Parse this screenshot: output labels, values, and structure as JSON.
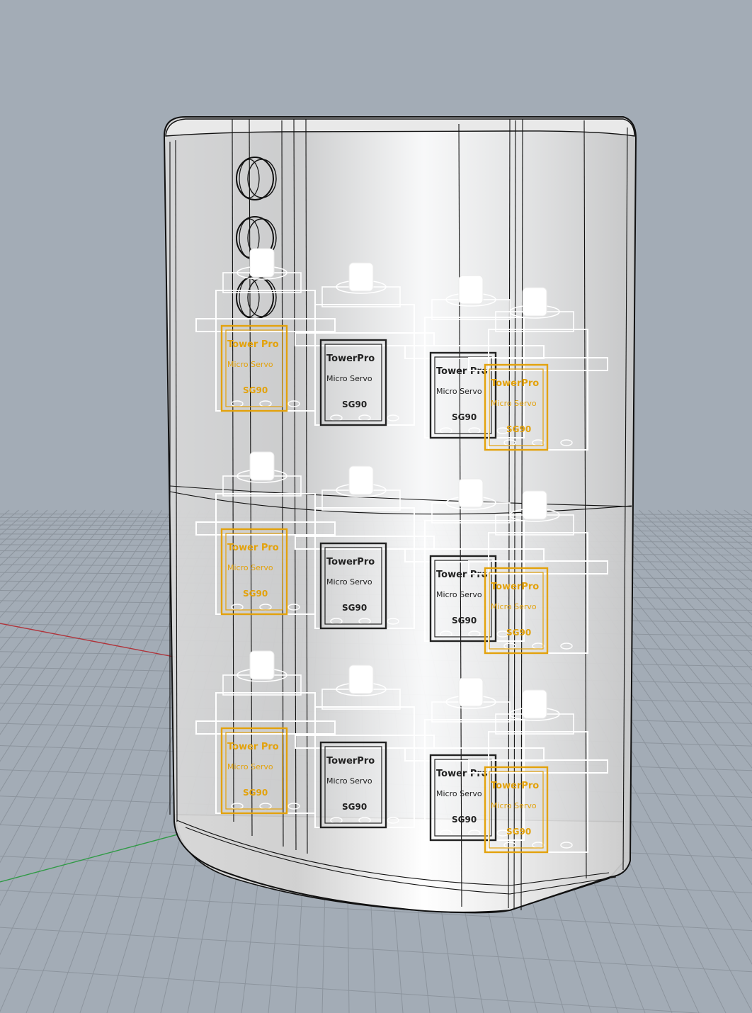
{
  "viewport": {
    "background": "#a3acb6",
    "grid_color": "#8c949d",
    "x_axis_color": "#b0333a",
    "y_axis_color": "#2f9a45"
  },
  "model": {
    "enclosure_fill": "#f1f1f1",
    "edge_color": "#111111",
    "servo_frame_color": "#ffffff",
    "label_primary_color": "#e3a20c",
    "label_secondary_color": "#222222",
    "servo_rows": 3,
    "servos_per_row": 4,
    "connector_holes": 3
  },
  "labels": {
    "brand_a": "Tower Pro",
    "brand_b": "TowerPro",
    "model_line": "Micro Servo",
    "part_no": "SG90"
  }
}
